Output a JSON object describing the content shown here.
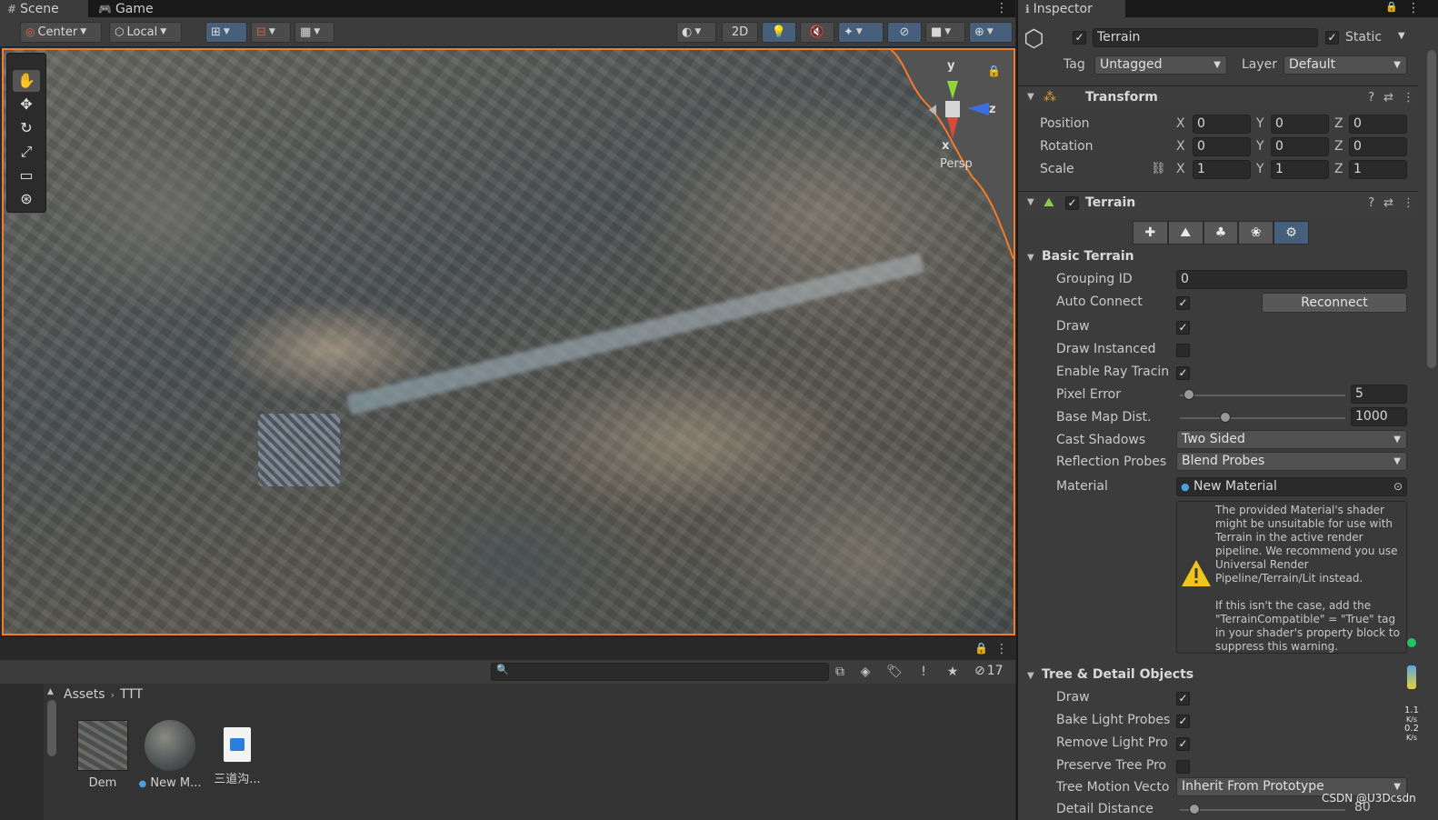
{
  "scene_tabs": [
    {
      "label": "Scene",
      "icon": "grid-icon"
    },
    {
      "label": "Game",
      "icon": "gamepad-icon"
    }
  ],
  "scene_toolbar": {
    "pivot_mode": "Center",
    "pivot_rotation": "Local",
    "mode_2d": "2D"
  },
  "gizmo": {
    "y_label": "y",
    "z_label": "z",
    "x_label": "x",
    "projection": "Persp"
  },
  "project": {
    "search_value": "",
    "hidden_count": "17",
    "breadcrumb": [
      "Assets",
      "TTT"
    ],
    "assets": [
      {
        "name": "Dem",
        "kind": "texture"
      },
      {
        "name": "New M...",
        "kind": "material"
      },
      {
        "name": "三道沟...",
        "kind": "image-file"
      }
    ]
  },
  "inspector": {
    "tab_label": "Inspector",
    "object_name": "Terrain",
    "static_label": "Static",
    "tag_label": "Tag",
    "tag_value": "Untagged",
    "layer_label": "Layer",
    "layer_value": "Default",
    "transform": {
      "title": "Transform",
      "position_label": "Position",
      "rotation_label": "Rotation",
      "scale_label": "Scale",
      "position": {
        "x": "0",
        "y": "0",
        "z": "0"
      },
      "rotation": {
        "x": "0",
        "y": "0",
        "z": "0"
      },
      "scale": {
        "x": "1",
        "y": "1",
        "z": "1"
      },
      "axis_x": "X",
      "axis_y": "Y",
      "axis_z": "Z"
    },
    "terrain": {
      "title": "Terrain",
      "basic_title": "Basic Terrain",
      "grouping_id_label": "Grouping ID",
      "grouping_id": "0",
      "auto_connect_label": "Auto Connect",
      "reconnect_label": "Reconnect",
      "draw_label": "Draw",
      "draw_instanced_label": "Draw Instanced",
      "ray_tracing_label": "Enable Ray Tracin",
      "pixel_error_label": "Pixel Error",
      "pixel_error": "5",
      "pixel_error_fraction": 0.02,
      "base_map_label": "Base Map Dist.",
      "base_map_dist": "1000",
      "base_map_fraction": 0.24,
      "cast_shadows_label": "Cast Shadows",
      "cast_shadows": "Two Sided",
      "reflection_probes_label": "Reflection Probes",
      "reflection_probes": "Blend Probes",
      "material_label": "Material",
      "material": "New Material",
      "warning_text_1": "The provided Material's shader might be unsuitable for use with Terrain in the active render pipeline. We recommend you use Universal Render Pipeline/Terrain/Lit instead.",
      "warning_text_2": "If this isn't the case, add the \"TerrainCompatible\" = \"True\" tag in your shader's property block to suppress this warning.",
      "tree_title": "Tree & Detail Objects",
      "tree_draw_label": "Draw",
      "bake_light_probes_label": "Bake Light Probes",
      "remove_light_probes_label": "Remove Light Pro",
      "preserve_tree_label": "Preserve Tree Pro",
      "tree_motion_label": "Tree Motion Vecto",
      "tree_motion_value": "Inherit From Prototype",
      "detail_distance_label": "Detail Distance",
      "detail_distance": "80"
    }
  },
  "net_monitor": {
    "up": "1.1",
    "up_unit": "K/s",
    "down": "0.2",
    "down_unit": "K/s"
  },
  "watermark": "CSDN @U3Dcsdn",
  "colors": {
    "selection_outline": "#f07b2b",
    "active_toggle": "#46607c",
    "panel_bg": "#3c3c3c"
  }
}
